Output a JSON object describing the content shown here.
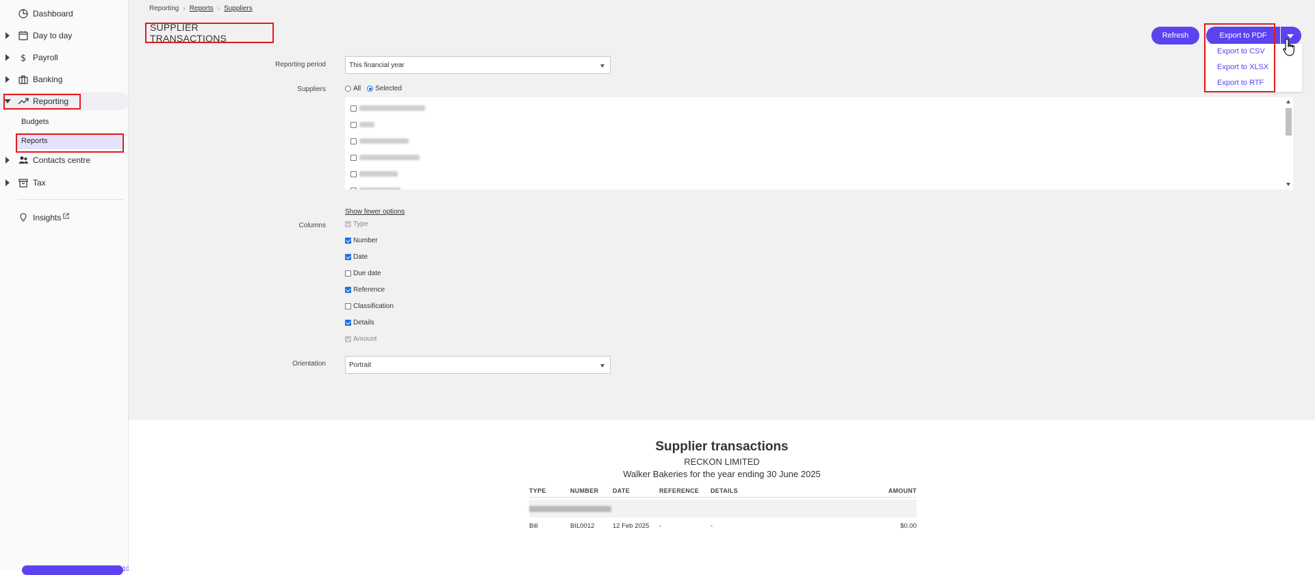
{
  "sidebar": {
    "items": [
      {
        "label": "Dashboard",
        "icon": "dashboard-icon"
      },
      {
        "label": "Day to day",
        "icon": "calendar-icon"
      },
      {
        "label": "Payroll",
        "icon": "dollar-icon"
      },
      {
        "label": "Banking",
        "icon": "bank-icon"
      },
      {
        "label": "Reporting",
        "icon": "trend-icon"
      },
      {
        "label": "Contacts centre",
        "icon": "contacts-icon"
      },
      {
        "label": "Tax",
        "icon": "archive-icon"
      },
      {
        "label": "Insights",
        "icon": "lightbulb-icon"
      }
    ],
    "reporting_sub": [
      "Budgets",
      "Reports"
    ],
    "bottom_badge": "10"
  },
  "breadcrumb": [
    "Reporting",
    "Reports",
    "Suppliers"
  ],
  "page_title": "SUPPLIER TRANSACTIONS",
  "toolbar": {
    "refresh_label": "Refresh",
    "export_label": "Export to PDF",
    "export_options": [
      "Export to CSV",
      "Export to XLSX",
      "Export to RTF"
    ]
  },
  "form": {
    "reporting_period_label": "Reporting period",
    "reporting_period_value": "This financial year",
    "suppliers_label": "Suppliers",
    "suppliers_all": "All",
    "suppliers_selected": "Selected",
    "show_fewer": "Show fewer options",
    "columns_label": "Columns",
    "columns": [
      {
        "label": "Type",
        "checked": true,
        "disabled": true
      },
      {
        "label": "Number",
        "checked": true,
        "disabled": false
      },
      {
        "label": "Date",
        "checked": true,
        "disabled": false
      },
      {
        "label": "Due date",
        "checked": false,
        "disabled": false
      },
      {
        "label": "Reference",
        "checked": true,
        "disabled": false
      },
      {
        "label": "Classification",
        "checked": false,
        "disabled": false
      },
      {
        "label": "Details",
        "checked": true,
        "disabled": false
      },
      {
        "label": "Amount",
        "checked": true,
        "disabled": true
      }
    ],
    "orientation_label": "Orientation",
    "orientation_value": "Portrait"
  },
  "report": {
    "title": "Supplier transactions",
    "company": "RECKON LIMITED",
    "subtitle": "Walker Bakeries for the year ending 30 June 2025",
    "headers": [
      "TYPE",
      "NUMBER",
      "DATE",
      "REFERENCE",
      "DETAILS",
      "AMOUNT"
    ],
    "row": {
      "type": "Bill",
      "number": "BIL0012",
      "date": "12 Feb 2025",
      "reference": "-",
      "details": "-",
      "amount": "$0.00"
    }
  },
  "colors": {
    "accent": "#5b44f0",
    "highlight": "#e11b1b",
    "checkbox": "#1a73e8"
  }
}
